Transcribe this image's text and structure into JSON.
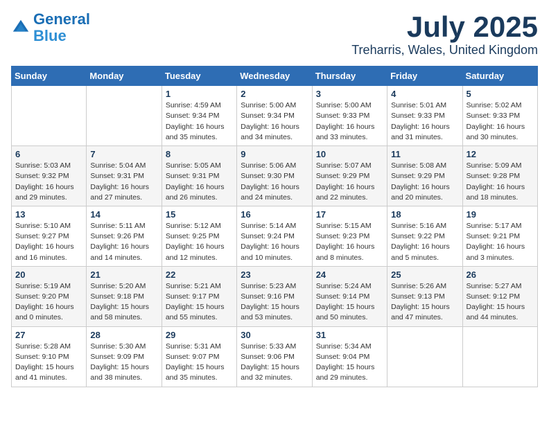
{
  "header": {
    "logo_line1": "General",
    "logo_line2": "Blue",
    "month_title": "July 2025",
    "location": "Treharris, Wales, United Kingdom"
  },
  "weekdays": [
    "Sunday",
    "Monday",
    "Tuesday",
    "Wednesday",
    "Thursday",
    "Friday",
    "Saturday"
  ],
  "weeks": [
    [
      {
        "day": "",
        "info": ""
      },
      {
        "day": "",
        "info": ""
      },
      {
        "day": "1",
        "info": "Sunrise: 4:59 AM\nSunset: 9:34 PM\nDaylight: 16 hours\nand 35 minutes."
      },
      {
        "day": "2",
        "info": "Sunrise: 5:00 AM\nSunset: 9:34 PM\nDaylight: 16 hours\nand 34 minutes."
      },
      {
        "day": "3",
        "info": "Sunrise: 5:00 AM\nSunset: 9:33 PM\nDaylight: 16 hours\nand 33 minutes."
      },
      {
        "day": "4",
        "info": "Sunrise: 5:01 AM\nSunset: 9:33 PM\nDaylight: 16 hours\nand 31 minutes."
      },
      {
        "day": "5",
        "info": "Sunrise: 5:02 AM\nSunset: 9:33 PM\nDaylight: 16 hours\nand 30 minutes."
      }
    ],
    [
      {
        "day": "6",
        "info": "Sunrise: 5:03 AM\nSunset: 9:32 PM\nDaylight: 16 hours\nand 29 minutes."
      },
      {
        "day": "7",
        "info": "Sunrise: 5:04 AM\nSunset: 9:31 PM\nDaylight: 16 hours\nand 27 minutes."
      },
      {
        "day": "8",
        "info": "Sunrise: 5:05 AM\nSunset: 9:31 PM\nDaylight: 16 hours\nand 26 minutes."
      },
      {
        "day": "9",
        "info": "Sunrise: 5:06 AM\nSunset: 9:30 PM\nDaylight: 16 hours\nand 24 minutes."
      },
      {
        "day": "10",
        "info": "Sunrise: 5:07 AM\nSunset: 9:29 PM\nDaylight: 16 hours\nand 22 minutes."
      },
      {
        "day": "11",
        "info": "Sunrise: 5:08 AM\nSunset: 9:29 PM\nDaylight: 16 hours\nand 20 minutes."
      },
      {
        "day": "12",
        "info": "Sunrise: 5:09 AM\nSunset: 9:28 PM\nDaylight: 16 hours\nand 18 minutes."
      }
    ],
    [
      {
        "day": "13",
        "info": "Sunrise: 5:10 AM\nSunset: 9:27 PM\nDaylight: 16 hours\nand 16 minutes."
      },
      {
        "day": "14",
        "info": "Sunrise: 5:11 AM\nSunset: 9:26 PM\nDaylight: 16 hours\nand 14 minutes."
      },
      {
        "day": "15",
        "info": "Sunrise: 5:12 AM\nSunset: 9:25 PM\nDaylight: 16 hours\nand 12 minutes."
      },
      {
        "day": "16",
        "info": "Sunrise: 5:14 AM\nSunset: 9:24 PM\nDaylight: 16 hours\nand 10 minutes."
      },
      {
        "day": "17",
        "info": "Sunrise: 5:15 AM\nSunset: 9:23 PM\nDaylight: 16 hours\nand 8 minutes."
      },
      {
        "day": "18",
        "info": "Sunrise: 5:16 AM\nSunset: 9:22 PM\nDaylight: 16 hours\nand 5 minutes."
      },
      {
        "day": "19",
        "info": "Sunrise: 5:17 AM\nSunset: 9:21 PM\nDaylight: 16 hours\nand 3 minutes."
      }
    ],
    [
      {
        "day": "20",
        "info": "Sunrise: 5:19 AM\nSunset: 9:20 PM\nDaylight: 16 hours\nand 0 minutes."
      },
      {
        "day": "21",
        "info": "Sunrise: 5:20 AM\nSunset: 9:18 PM\nDaylight: 15 hours\nand 58 minutes."
      },
      {
        "day": "22",
        "info": "Sunrise: 5:21 AM\nSunset: 9:17 PM\nDaylight: 15 hours\nand 55 minutes."
      },
      {
        "day": "23",
        "info": "Sunrise: 5:23 AM\nSunset: 9:16 PM\nDaylight: 15 hours\nand 53 minutes."
      },
      {
        "day": "24",
        "info": "Sunrise: 5:24 AM\nSunset: 9:14 PM\nDaylight: 15 hours\nand 50 minutes."
      },
      {
        "day": "25",
        "info": "Sunrise: 5:26 AM\nSunset: 9:13 PM\nDaylight: 15 hours\nand 47 minutes."
      },
      {
        "day": "26",
        "info": "Sunrise: 5:27 AM\nSunset: 9:12 PM\nDaylight: 15 hours\nand 44 minutes."
      }
    ],
    [
      {
        "day": "27",
        "info": "Sunrise: 5:28 AM\nSunset: 9:10 PM\nDaylight: 15 hours\nand 41 minutes."
      },
      {
        "day": "28",
        "info": "Sunrise: 5:30 AM\nSunset: 9:09 PM\nDaylight: 15 hours\nand 38 minutes."
      },
      {
        "day": "29",
        "info": "Sunrise: 5:31 AM\nSunset: 9:07 PM\nDaylight: 15 hours\nand 35 minutes."
      },
      {
        "day": "30",
        "info": "Sunrise: 5:33 AM\nSunset: 9:06 PM\nDaylight: 15 hours\nand 32 minutes."
      },
      {
        "day": "31",
        "info": "Sunrise: 5:34 AM\nSunset: 9:04 PM\nDaylight: 15 hours\nand 29 minutes."
      },
      {
        "day": "",
        "info": ""
      },
      {
        "day": "",
        "info": ""
      }
    ]
  ]
}
